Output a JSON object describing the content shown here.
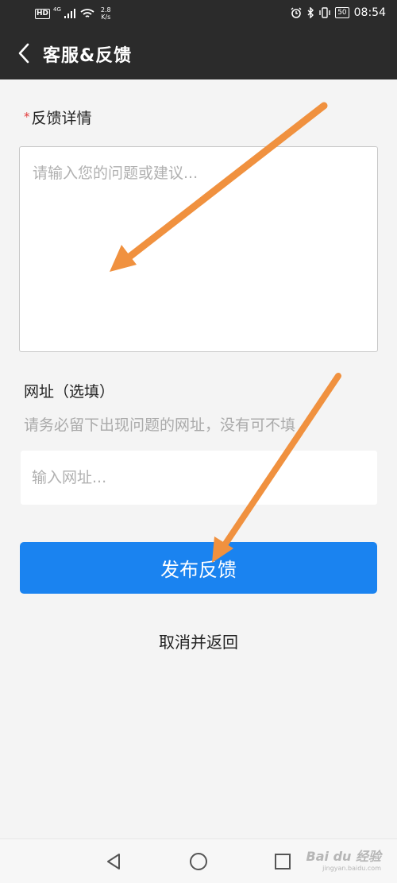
{
  "status_bar": {
    "hd_badge": "HD",
    "network_type": "4G",
    "speed_value": "2.8",
    "speed_unit": "K/s",
    "battery": "50",
    "time": "08:54"
  },
  "app_bar": {
    "title": "客服&反馈",
    "back_icon": "chevron-left-icon"
  },
  "feedback": {
    "required_mark": "*",
    "detail_label": "反馈详情",
    "detail_placeholder": "请输入您的问题或建议...",
    "url_label": "网址（选填）",
    "url_hint": "请务必留下出现问题的网址，没有可不填",
    "url_placeholder": "输入网址..."
  },
  "actions": {
    "submit_label": "发布反馈",
    "cancel_label": "取消并返回"
  },
  "nav_bar": {
    "back_icon": "triangle-back-icon",
    "home_icon": "circle-home-icon",
    "recents_icon": "square-recents-icon"
  },
  "watermark": {
    "text": "Bai du 经验",
    "sub": "jingyan.baidu.com"
  },
  "colors": {
    "app_bar_bg": "#2b2b2b",
    "primary": "#1a83f0",
    "required": "#e23a3a",
    "annotation_arrow": "#f0913f"
  }
}
